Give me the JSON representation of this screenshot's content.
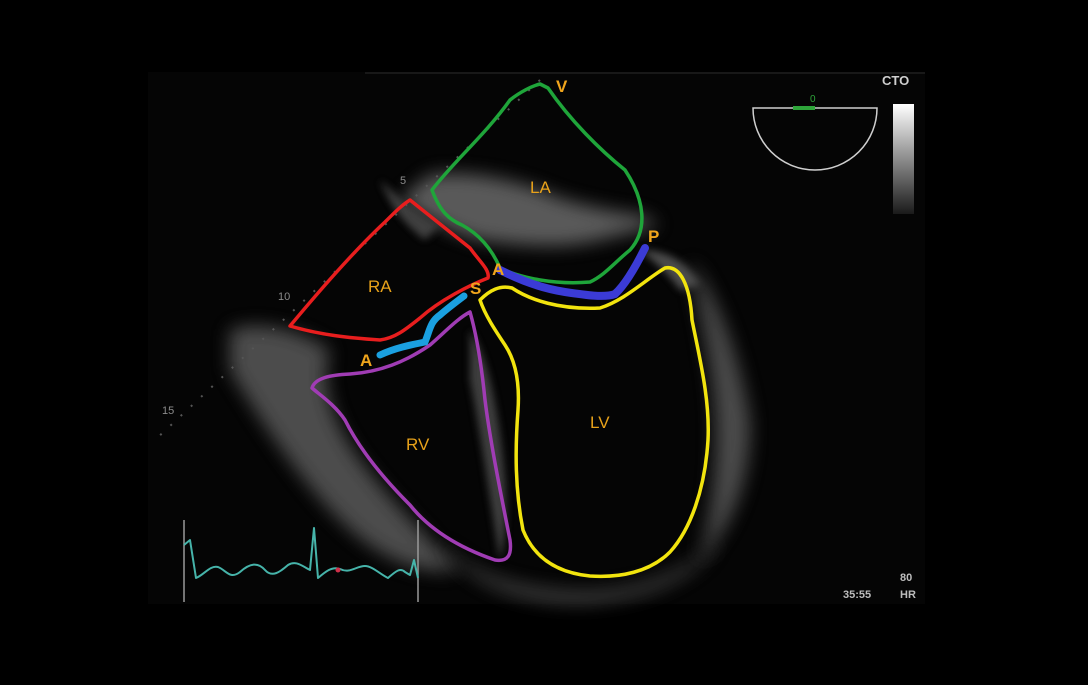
{
  "image": {
    "brand": "CTO",
    "probe_angle": "0",
    "time": "35:55",
    "heart_rate_value": "80",
    "heart_rate_unit": "HR",
    "depth_markers": [
      "5",
      "10",
      "15"
    ]
  },
  "chambers": {
    "la": "LA",
    "ra": "RA",
    "rv": "RV",
    "lv": "LV"
  },
  "markers": {
    "v": "V",
    "p": "P",
    "a_upper": "A",
    "s": "S",
    "a_lower": "A"
  },
  "colors": {
    "la_outline": "#1fa53a",
    "ra_outline": "#e81e1e",
    "rv_outline": "#a03cb4",
    "lv_outline": "#f2e40e",
    "posterior_leaflet": "#3b3bd6",
    "anterior_leaflet": "#1aa0e0",
    "label": "#e8a21a",
    "ecg": "#46b4aa"
  }
}
